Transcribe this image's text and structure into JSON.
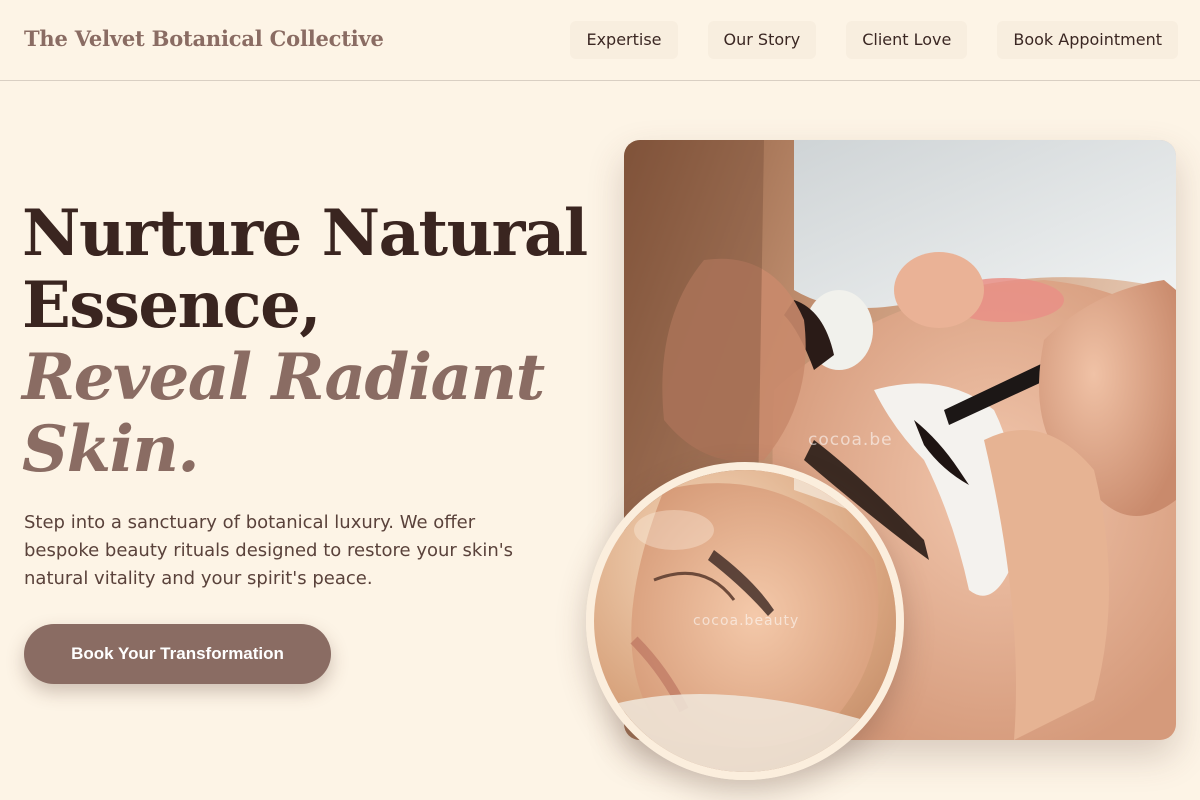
{
  "header": {
    "brand": "The Velvet Botanical Collective",
    "nav": [
      {
        "label": "Expertise"
      },
      {
        "label": "Our Story"
      },
      {
        "label": "Client Love"
      },
      {
        "label": "Book Appointment"
      }
    ]
  },
  "hero": {
    "headline_line1": "Nurture Natural",
    "headline_line2": "Essence,",
    "headline_accent_line1": "Reveal Radiant",
    "headline_accent_line2": "Skin.",
    "description": "Step into a sanctuary of botanical luxury. We offer bespoke beauty rituals designed to restore your skin's natural vitality and your spirit's peace.",
    "cta_label": "Book Your Transformation"
  },
  "images": {
    "main_watermark": "cocoa.be",
    "round_watermark": "cocoa.beauty"
  },
  "colors": {
    "background": "#fdf4e6",
    "primary_text": "#3a2520",
    "accent": "#8a6c63",
    "nav_pill": "#f8eedf"
  }
}
